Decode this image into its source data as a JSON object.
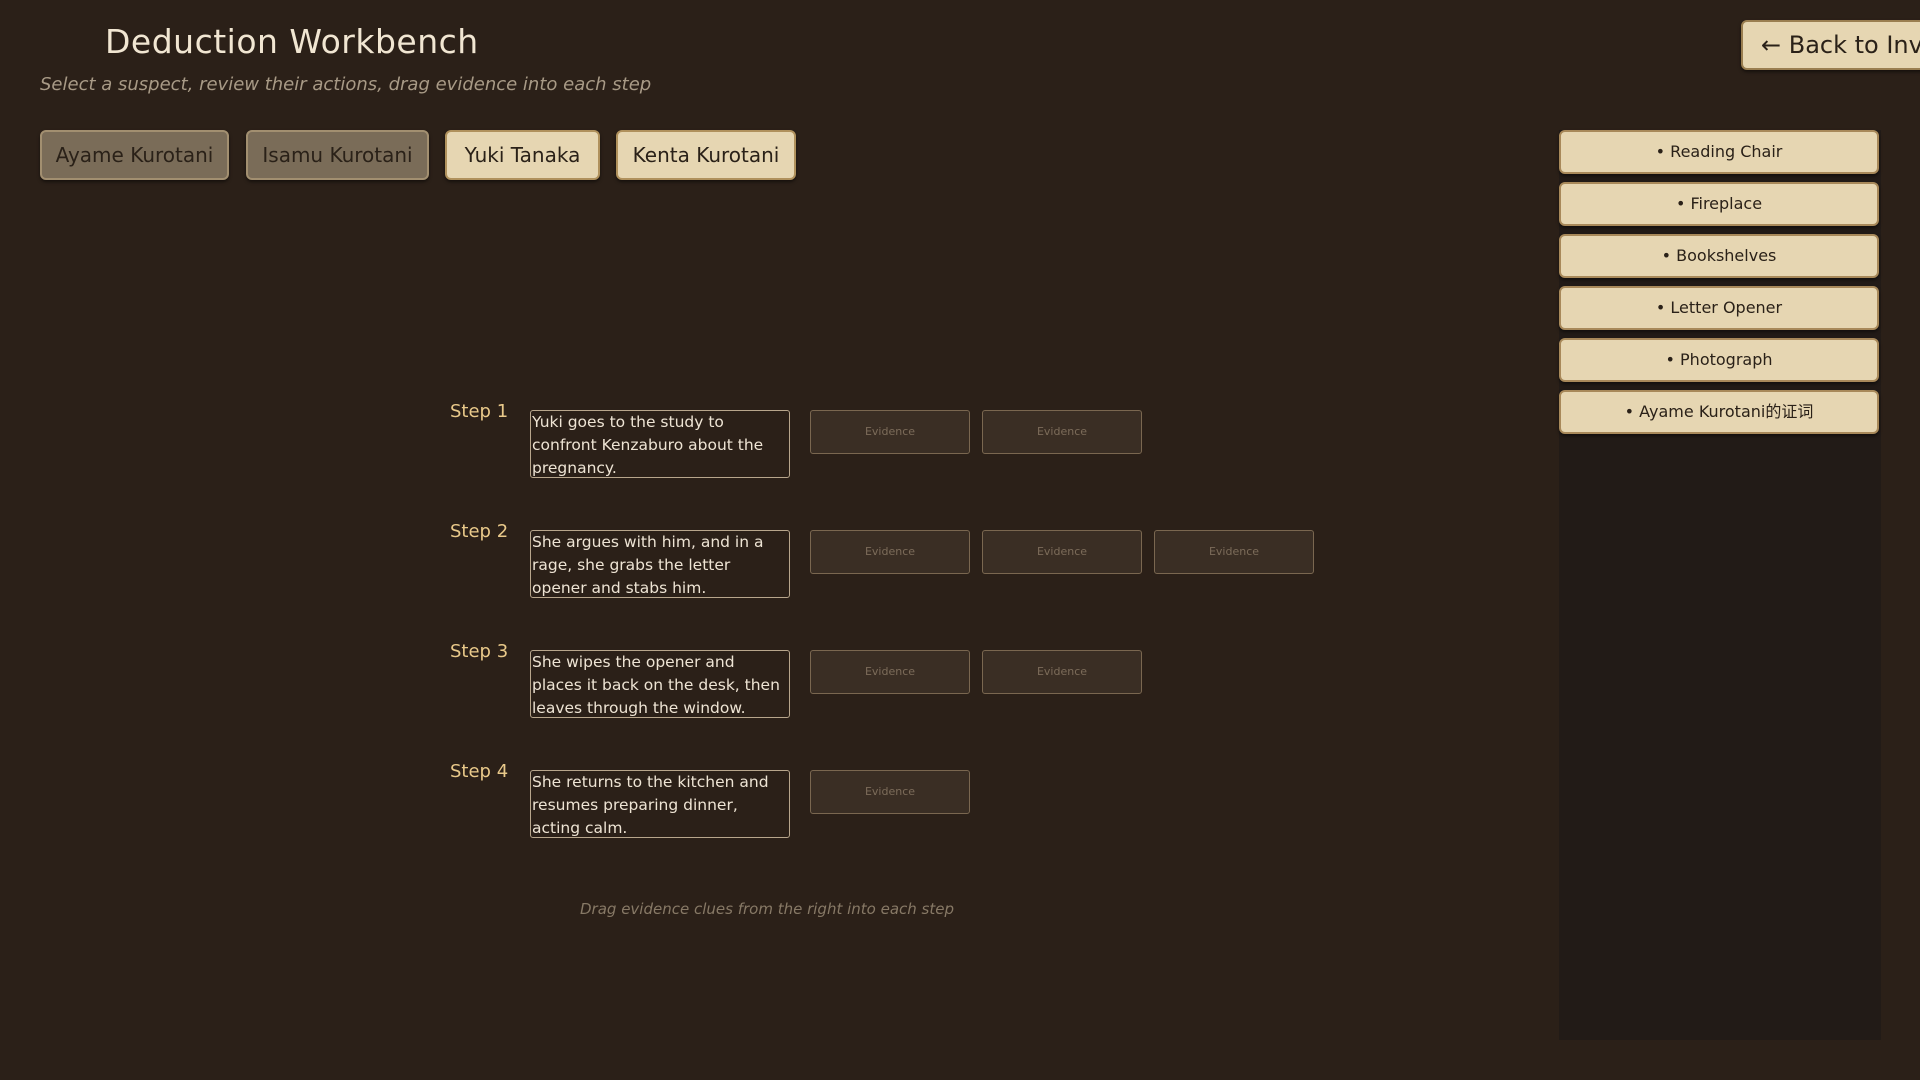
{
  "header": {
    "title": "Deduction Workbench",
    "subtitle": "Select a suspect, review their actions, drag evidence into each step",
    "back_label": "← Back to Inve"
  },
  "suspects": [
    {
      "name": "Ayame Kurotani",
      "state": "dim"
    },
    {
      "name": "Isamu Kurotani",
      "state": "dim"
    },
    {
      "name": "Yuki Tanaka",
      "state": "active"
    },
    {
      "name": "Kenta Kurotani",
      "state": "active"
    }
  ],
  "evidence": [
    "• Reading Chair",
    "• Fireplace",
    "• Bookshelves",
    "• Letter Opener",
    "• Photograph",
    "• Ayame Kurotani的证词"
  ],
  "steps": [
    {
      "label": "Step 1",
      "text": "Yuki goes to the study to confront Kenzaburo about the pregnancy.",
      "slots": [
        "Evidence",
        "Evidence"
      ]
    },
    {
      "label": "Step 2",
      "text": "She argues with him, and in a rage, she grabs the letter opener and stabs him.",
      "slots": [
        "Evidence",
        "Evidence",
        "Evidence"
      ]
    },
    {
      "label": "Step 3",
      "text": "She wipes the opener and places it back on the desk, then leaves through the window.",
      "slots": [
        "Evidence",
        "Evidence"
      ]
    },
    {
      "label": "Step 4",
      "text": "She returns to the kitchen and resumes preparing dinner, acting calm.",
      "slots": [
        "Evidence"
      ]
    }
  ],
  "hint": "Drag evidence clues from the right into each step"
}
